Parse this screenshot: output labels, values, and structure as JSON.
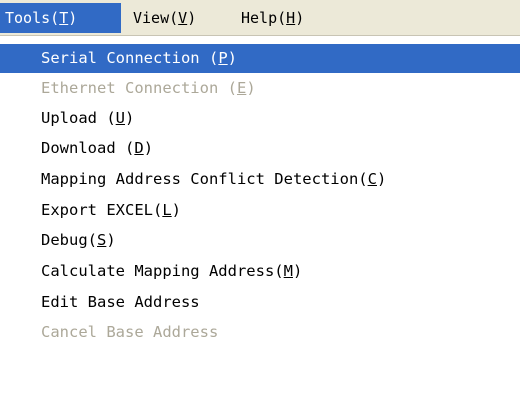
{
  "menubar": {
    "items": [
      {
        "label": "Tools",
        "mnemonic": "T",
        "active": true
      },
      {
        "label": "View",
        "mnemonic": "V",
        "active": false
      },
      {
        "label": "Help",
        "mnemonic": "H",
        "active": false
      }
    ]
  },
  "tools_menu": {
    "items": [
      {
        "label": "Serial Connection ",
        "mnemonic": "P",
        "state": "highlighted"
      },
      {
        "label": "Ethernet Connection ",
        "mnemonic": "E",
        "state": "disabled"
      },
      {
        "label": "Upload ",
        "mnemonic": "U",
        "state": "enabled"
      },
      {
        "label": "Download ",
        "mnemonic": "D",
        "state": "enabled"
      },
      {
        "label": "Mapping Address Conflict Detection",
        "mnemonic": "C",
        "state": "enabled"
      },
      {
        "label": "Export EXCEL",
        "mnemonic": "L",
        "state": "enabled"
      },
      {
        "label": "Debug",
        "mnemonic": "S",
        "state": "enabled"
      },
      {
        "label": "Calculate Mapping Address",
        "mnemonic": "M",
        "state": "enabled"
      },
      {
        "label": "Edit Base Address",
        "mnemonic": "",
        "state": "enabled"
      },
      {
        "label": "Cancel Base Address",
        "mnemonic": "",
        "state": "disabled"
      }
    ]
  },
  "colors": {
    "highlight": "#316ac5",
    "menubar_bg": "#ece9d8",
    "disabled_text": "#aca899"
  }
}
